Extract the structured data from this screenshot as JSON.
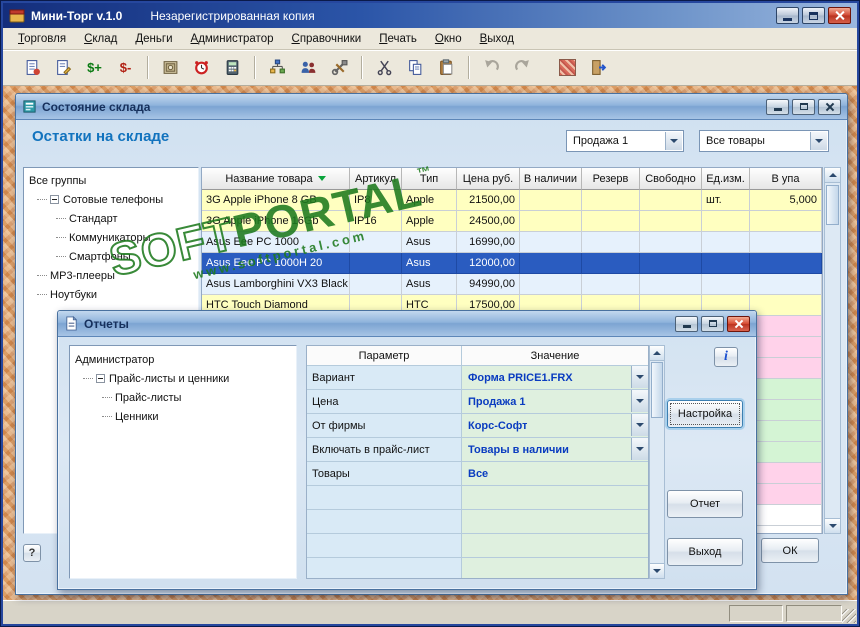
{
  "colors": {
    "title_gradient_start": "#142e7c",
    "heading_blue": "#1273be",
    "row_yellow": "#ffffc0",
    "row_blue": "#e6f1fc",
    "row_selected_bg": "#2a5cc0",
    "row_pink": "#ffd2ea",
    "row_green": "#d4f4d4",
    "param_cell_bg": "#d9eaf6",
    "value_cell_bg": "#dff0df",
    "value_text": "#0a3cc0",
    "watermark_green": "#1e7a1e"
  },
  "main_window": {
    "title": "Мини-Торг v.1.0",
    "registration_notice": "Незарегистрированная копия",
    "menu_items": [
      "Торговля",
      "Склад",
      "Деньги",
      "Администратор",
      "Справочники",
      "Печать",
      "Окно",
      "Выход"
    ],
    "toolbar": {
      "money_plus": "$+",
      "money_minus": "$-"
    }
  },
  "warehouse_window": {
    "title": "Состояние склада",
    "heading": "Остатки на складе",
    "price_type_combo": "Продажа 1",
    "goods_filter_combo": "Все товары",
    "group_tree": {
      "root": "Все группы",
      "nodes": [
        {
          "label": "Сотовые телефоны"
        },
        {
          "label": "Стандарт"
        },
        {
          "label": "Коммуникаторы"
        },
        {
          "label": "Смартфоны"
        },
        {
          "label": "МР3-плееры"
        },
        {
          "label": "Ноутбуки"
        }
      ]
    },
    "table": {
      "columns": [
        "Название товара",
        "Артикул",
        "Тип",
        "Цена руб.",
        "В наличии",
        "Резерв",
        "Свободно",
        "Ед.изм.",
        "В упа"
      ],
      "rows": [
        {
          "name": "3G Apple iPhone  8 GB",
          "article": "IP8",
          "type": "Apple",
          "price": "21500,00",
          "available": "",
          "reserve": "",
          "free": "",
          "unit": "шт.",
          "pack": "5,000"
        },
        {
          "name": "3G Apple iPhone 16Gb",
          "article": "IP16",
          "type": "Apple",
          "price": "24500,00",
          "available": "",
          "reserve": "",
          "free": "",
          "unit": "",
          "pack": ""
        },
        {
          "name": "Asus Eee PC 1000",
          "article": "",
          "type": "Asus",
          "price": "16990,00",
          "available": "",
          "reserve": "",
          "free": "",
          "unit": "",
          "pack": ""
        },
        {
          "name": "Asus Eee PC 1000H 20",
          "article": "",
          "type": "Asus",
          "price": "12000,00",
          "available": "",
          "reserve": "",
          "free": "",
          "unit": "",
          "pack": ""
        },
        {
          "name": "Asus Lamborghini VX3 Black",
          "article": "",
          "type": "Asus",
          "price": "94990,00",
          "available": "",
          "reserve": "",
          "free": "",
          "unit": "",
          "pack": ""
        },
        {
          "name": "HTC Touch Diamond",
          "article": "",
          "type": "HTC",
          "price": "17500,00",
          "available": "",
          "reserve": "",
          "free": "",
          "unit": "",
          "pack": ""
        }
      ]
    },
    "ok_button": "ОК",
    "help_button": "?"
  },
  "reports_window": {
    "title": "Отчеты",
    "report_tree": {
      "root": "Администратор",
      "nodes": [
        {
          "label": "Прайс-листы и ценники"
        },
        {
          "label": "Прайс-листы"
        },
        {
          "label": "Ценники"
        }
      ]
    },
    "parameters": {
      "columns": [
        "Параметр",
        "Значение"
      ],
      "rows": [
        {
          "param": "Вариант",
          "value": "Форма PRICE1.FRX"
        },
        {
          "param": "Цена",
          "value": "Продажа 1"
        },
        {
          "param": "От фирмы",
          "value": "Корс-Софт"
        },
        {
          "param": "Включать в прайс-лист",
          "value": "Товары в наличии"
        },
        {
          "param": "Товары",
          "value": "Все"
        }
      ]
    },
    "buttons": {
      "info": "i",
      "settings": "Настройка",
      "report": "Отчет",
      "exit": "Выход"
    }
  },
  "watermark": {
    "brand_outline": "SOFT",
    "brand_solid": "PORTAL",
    "trademark": "™",
    "url": "www.softportal.com"
  }
}
